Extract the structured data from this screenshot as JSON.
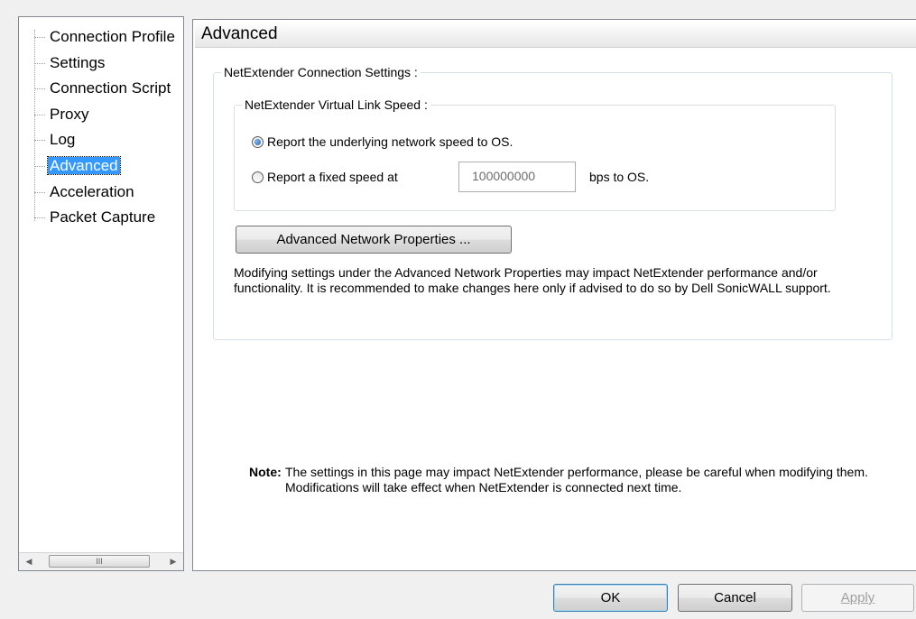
{
  "tree": {
    "items": [
      {
        "label": "Connection Profile"
      },
      {
        "label": "Settings"
      },
      {
        "label": "Connection Script"
      },
      {
        "label": "Proxy"
      },
      {
        "label": "Log"
      },
      {
        "label": "Advanced",
        "selected": true
      },
      {
        "label": "Acceleration"
      },
      {
        "label": "Packet Capture"
      }
    ],
    "scrollbar": {
      "thumb_grip": "III"
    }
  },
  "page": {
    "title": "Advanced",
    "connection_group": {
      "legend": "NetExtender Connection Settings :",
      "link_speed_group": {
        "legend": "NetExtender Virtual Link Speed :",
        "option_report_underlying": "Report the underlying network speed to OS.",
        "option_report_fixed": "Report a fixed speed at",
        "fixed_speed_value": "100000000",
        "fixed_speed_unit": "bps to OS.",
        "selected": "report_underlying"
      },
      "advanced_props_button": "Advanced Network Properties ...",
      "description": "Modifying settings under the Advanced Network Properties may impact NetExtender performance and/or functionality. It is recommended to make changes here only if advised to do so by Dell SonicWALL support."
    },
    "note_label": "Note:",
    "note_text": "The settings in this page may impact NetExtender performance, please be careful when modifying them. Modifications will take effect when NetExtender is connected next time."
  },
  "buttons": {
    "ok": "OK",
    "cancel": "Cancel",
    "apply": "Apply"
  }
}
